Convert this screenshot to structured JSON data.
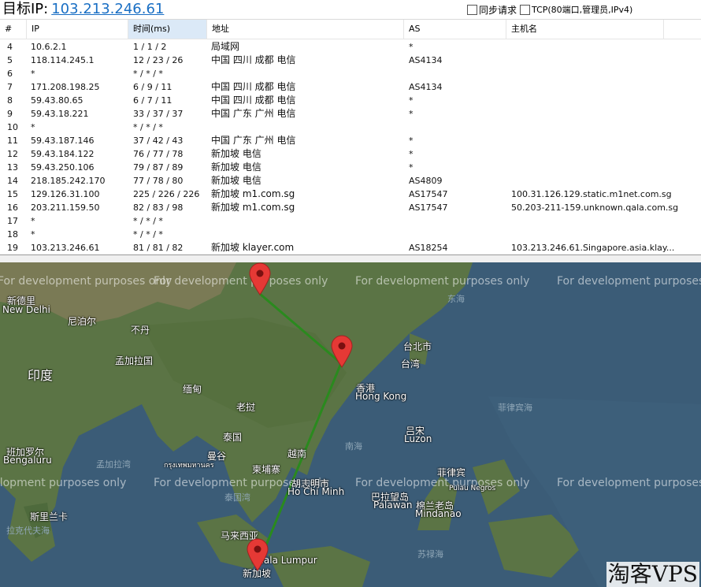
{
  "header": {
    "target_label": "目标IP:",
    "target_ip": "103.213.246.61",
    "options": [
      {
        "label": "同步请求",
        "checked": false
      },
      {
        "label": "TCP(80端口,管理员,IPv4)",
        "checked": false
      }
    ]
  },
  "table": {
    "columns": [
      "#",
      "IP",
      "时间(ms)",
      "地址",
      "AS",
      "主机名"
    ],
    "rows": [
      {
        "num": "4",
        "ip": "10.6.2.1",
        "time": "1 / 1 / 2",
        "addr": "局域网",
        "as": "*",
        "host": ""
      },
      {
        "num": "5",
        "ip": "118.114.245.1",
        "time": "12 / 23 / 26",
        "addr": "中国 四川 成都 电信",
        "as": "AS4134",
        "host": ""
      },
      {
        "num": "6",
        "ip": "*",
        "time": "* / * / *",
        "addr": "",
        "as": "",
        "host": ""
      },
      {
        "num": "7",
        "ip": "171.208.198.25",
        "time": "6 / 9 / 11",
        "addr": "中国 四川 成都 电信",
        "as": "AS4134",
        "host": ""
      },
      {
        "num": "8",
        "ip": "59.43.80.65",
        "time": "6 / 7 / 11",
        "addr": "中国 四川 成都 电信",
        "as": "*",
        "host": ""
      },
      {
        "num": "9",
        "ip": "59.43.18.221",
        "time": "33 / 37 / 37",
        "addr": "中国 广东 广州 电信",
        "as": "*",
        "host": ""
      },
      {
        "num": "10",
        "ip": "*",
        "time": "* / * / *",
        "addr": "",
        "as": "",
        "host": ""
      },
      {
        "num": "11",
        "ip": "59.43.187.146",
        "time": "37 / 42 / 43",
        "addr": "中国 广东 广州 电信",
        "as": "*",
        "host": ""
      },
      {
        "num": "12",
        "ip": "59.43.184.122",
        "time": "76 / 77 / 78",
        "addr": "新加坡 电信",
        "as": "*",
        "host": ""
      },
      {
        "num": "13",
        "ip": "59.43.250.106",
        "time": "79 / 87 / 89",
        "addr": "新加坡 电信",
        "as": "*",
        "host": ""
      },
      {
        "num": "14",
        "ip": "218.185.242.170",
        "time": "77 / 78 / 80",
        "addr": "新加坡 电信",
        "as": "AS4809",
        "host": ""
      },
      {
        "num": "15",
        "ip": "129.126.31.100",
        "time": "225 / 226 / 226",
        "addr": "新加坡 m1.com.sg",
        "as": "AS17547",
        "host": "100.31.126.129.static.m1net.com.sg"
      },
      {
        "num": "16",
        "ip": "203.211.159.50",
        "time": "82 / 83 / 98",
        "addr": "新加坡 m1.com.sg",
        "as": "AS17547",
        "host": "50.203-211-159.unknown.qala.com.sg"
      },
      {
        "num": "17",
        "ip": "*",
        "time": "* / * / *",
        "addr": "",
        "as": "",
        "host": ""
      },
      {
        "num": "18",
        "ip": "*",
        "time": "* / * / *",
        "addr": "",
        "as": "",
        "host": ""
      },
      {
        "num": "19",
        "ip": "103.213.246.61",
        "time": "81 / 81 / 82",
        "addr": "新加坡 klayer.com",
        "as": "AS18254",
        "host": "103.213.246.61.Singapore.asia.klay..."
      }
    ]
  },
  "map": {
    "watermark": "For development purposes only",
    "labels": {
      "new_delhi_cn": "新德里",
      "new_delhi_en": "New Delhi",
      "nepal": "尼泊尔",
      "bhutan": "不丹",
      "india": "印度",
      "bangladesh": "孟加拉国",
      "myanmar": "缅甸",
      "laos": "老挝",
      "thailand": "泰国",
      "bangkok_cn": "曼谷",
      "bangkok_th": "กรุงเทพมหานคร",
      "cambodia": "柬埔寨",
      "vietnam": "越南",
      "hcm_cn": "胡志明市",
      "hcm_en": "Ho Chi Minh",
      "bengaluru_cn": "班加罗尔",
      "bengaluru_en": "Bengaluru",
      "sri_lanka": "斯里兰卡",
      "malaysia": "马来西亚",
      "kl_en": "Kuala Lumpur",
      "singapore": "新加坡",
      "hong_kong_cn": "香港",
      "hong_kong_en": "Hong Kong",
      "taipei": "台北市",
      "taiwan": "台湾",
      "luzon_cn": "吕宋",
      "luzon_en": "Luzon",
      "philippines": "菲律宾",
      "palawan_cn": "巴拉望岛",
      "palawan_en": "Palawan",
      "mindanao_cn": "棉兰老岛",
      "mindanao_en": "Mindanao",
      "east_china_sea": "东海",
      "south_china_sea": "南海",
      "philippine_sea": "菲律宾海",
      "bay_of_bengal": "孟加拉湾",
      "gulf_of_thailand": "泰国湾",
      "laccadive_sea": "拉克代夫海",
      "celebes_sea": "苏禄海",
      "sulu_en": "Pulau Negros"
    },
    "route_color": "#2a8a1e",
    "pin_color": "#e53935"
  },
  "corner_brand": "淘客VPS"
}
